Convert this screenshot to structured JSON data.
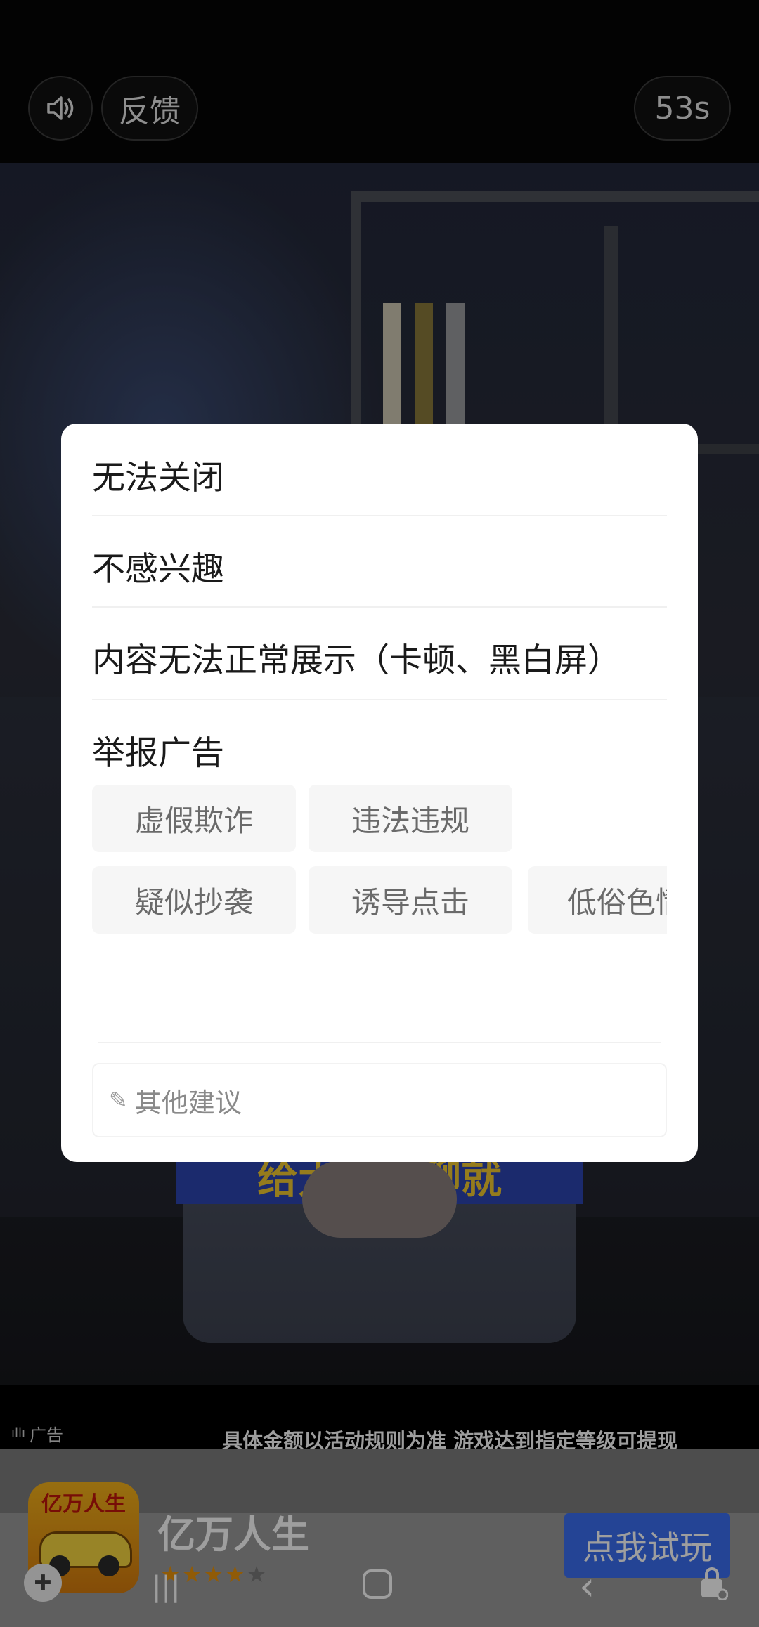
{
  "topbar": {
    "sound_icon": "speaker-icon",
    "feedback_label": "反馈",
    "countdown": "53s"
  },
  "video": {
    "banner_text": "给大家聊聊就"
  },
  "ad": {
    "tag_label": "广告",
    "marquee": "具体金额以活动规则为准 游戏达到指定等级可提现",
    "app_icon_text": "亿万人生",
    "app_name": "亿万人生",
    "rating": 4,
    "rating_max": 5,
    "cta": "点我试玩"
  },
  "modal": {
    "options": [
      "无法关闭",
      "不感兴趣",
      "内容无法正常展示（卡顿、黑白屏）"
    ],
    "report_title": "举报广告",
    "report_reasons_row1": [
      "虚假欺诈",
      "违法违规"
    ],
    "report_reasons_row2": [
      "疑似抄袭",
      "诱导点击",
      "低俗色情"
    ],
    "suggestion_placeholder": "其他建议",
    "suggestion_icon": "pencil-icon"
  },
  "navbar": {
    "icons": [
      "game-controller-icon",
      "recent-apps-icon",
      "home-icon",
      "back-icon",
      "lock-icon"
    ]
  }
}
